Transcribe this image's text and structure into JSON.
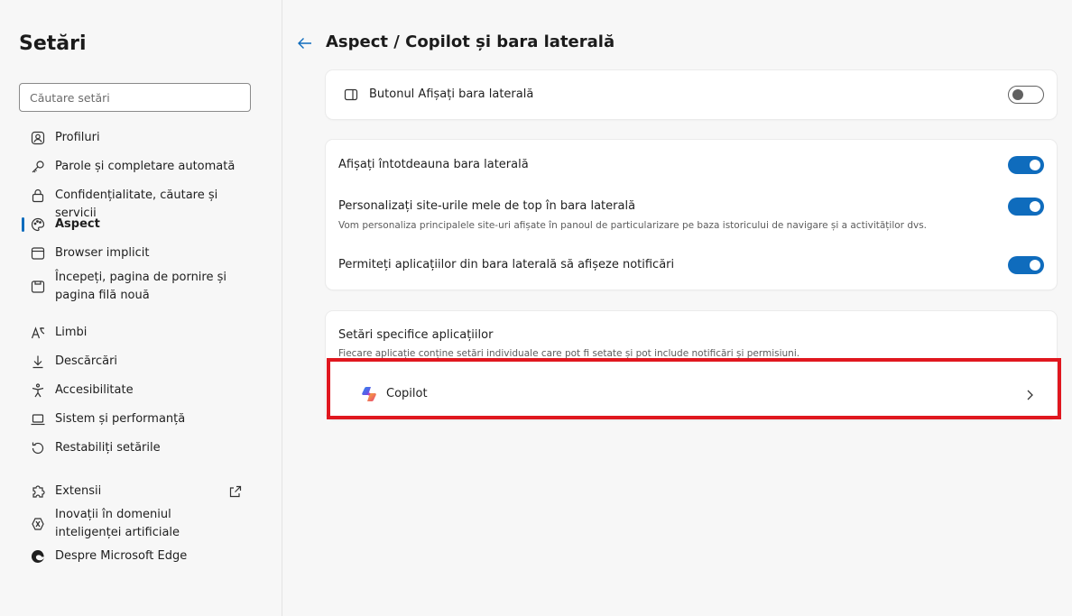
{
  "sidebar": {
    "title": "Setări",
    "search_placeholder": "Căutare setări",
    "items": [
      {
        "label": "Profiluri",
        "icon": "profile-icon"
      },
      {
        "label": "Parole și completare automată",
        "icon": "key-icon"
      },
      {
        "label": "Confidențialitate, căutare și servicii",
        "icon": "lock-icon"
      },
      {
        "label": "Aspect",
        "icon": "palette-icon",
        "active": true
      },
      {
        "label": "Browser implicit",
        "icon": "browser-icon"
      },
      {
        "label": "Începeți, pagina de pornire și pagina filă nouă",
        "icon": "home-page-icon"
      },
      {
        "label": "Limbi",
        "icon": "language-icon"
      },
      {
        "label": "Descărcări",
        "icon": "download-icon"
      },
      {
        "label": "Accesibilitate",
        "icon": "accessibility-icon"
      },
      {
        "label": "Sistem și performanță",
        "icon": "laptop-icon"
      },
      {
        "label": "Restabiliți setările",
        "icon": "reset-icon"
      },
      {
        "label": "Extensii",
        "icon": "puzzle-icon"
      },
      {
        "label": "Inovații în domeniul inteligenței artificiale",
        "icon": "ai-icon"
      },
      {
        "label": "Despre Microsoft Edge",
        "icon": "edge-icon"
      }
    ]
  },
  "main": {
    "title": "Aspect / Copilot și bara laterală",
    "card1": {
      "label": "Butonul Afișați bara laterală",
      "toggle": false
    },
    "card2": {
      "row1": {
        "label": "Afișați întotdeauna bara laterală",
        "toggle": true
      },
      "row2": {
        "label": "Personalizați site-urile mele de top în bara laterală",
        "sub": "Vom personaliza principalele site-uri afișate în panoul de particularizare pe baza istoricului de navigare și a activităților dvs.",
        "toggle": true
      },
      "row3": {
        "label": "Permiteți aplicațiilor din bara laterală să afișeze notificări",
        "toggle": true
      }
    },
    "card3": {
      "title": "Setări specifice aplicațiilor",
      "sub": "Fiecare aplicație conține setări individuale care pot fi setate și pot include notificări și permisiuni.",
      "app": "Copilot"
    }
  },
  "colors": {
    "accent": "#0f6cbd",
    "highlight": "#e0171f"
  }
}
